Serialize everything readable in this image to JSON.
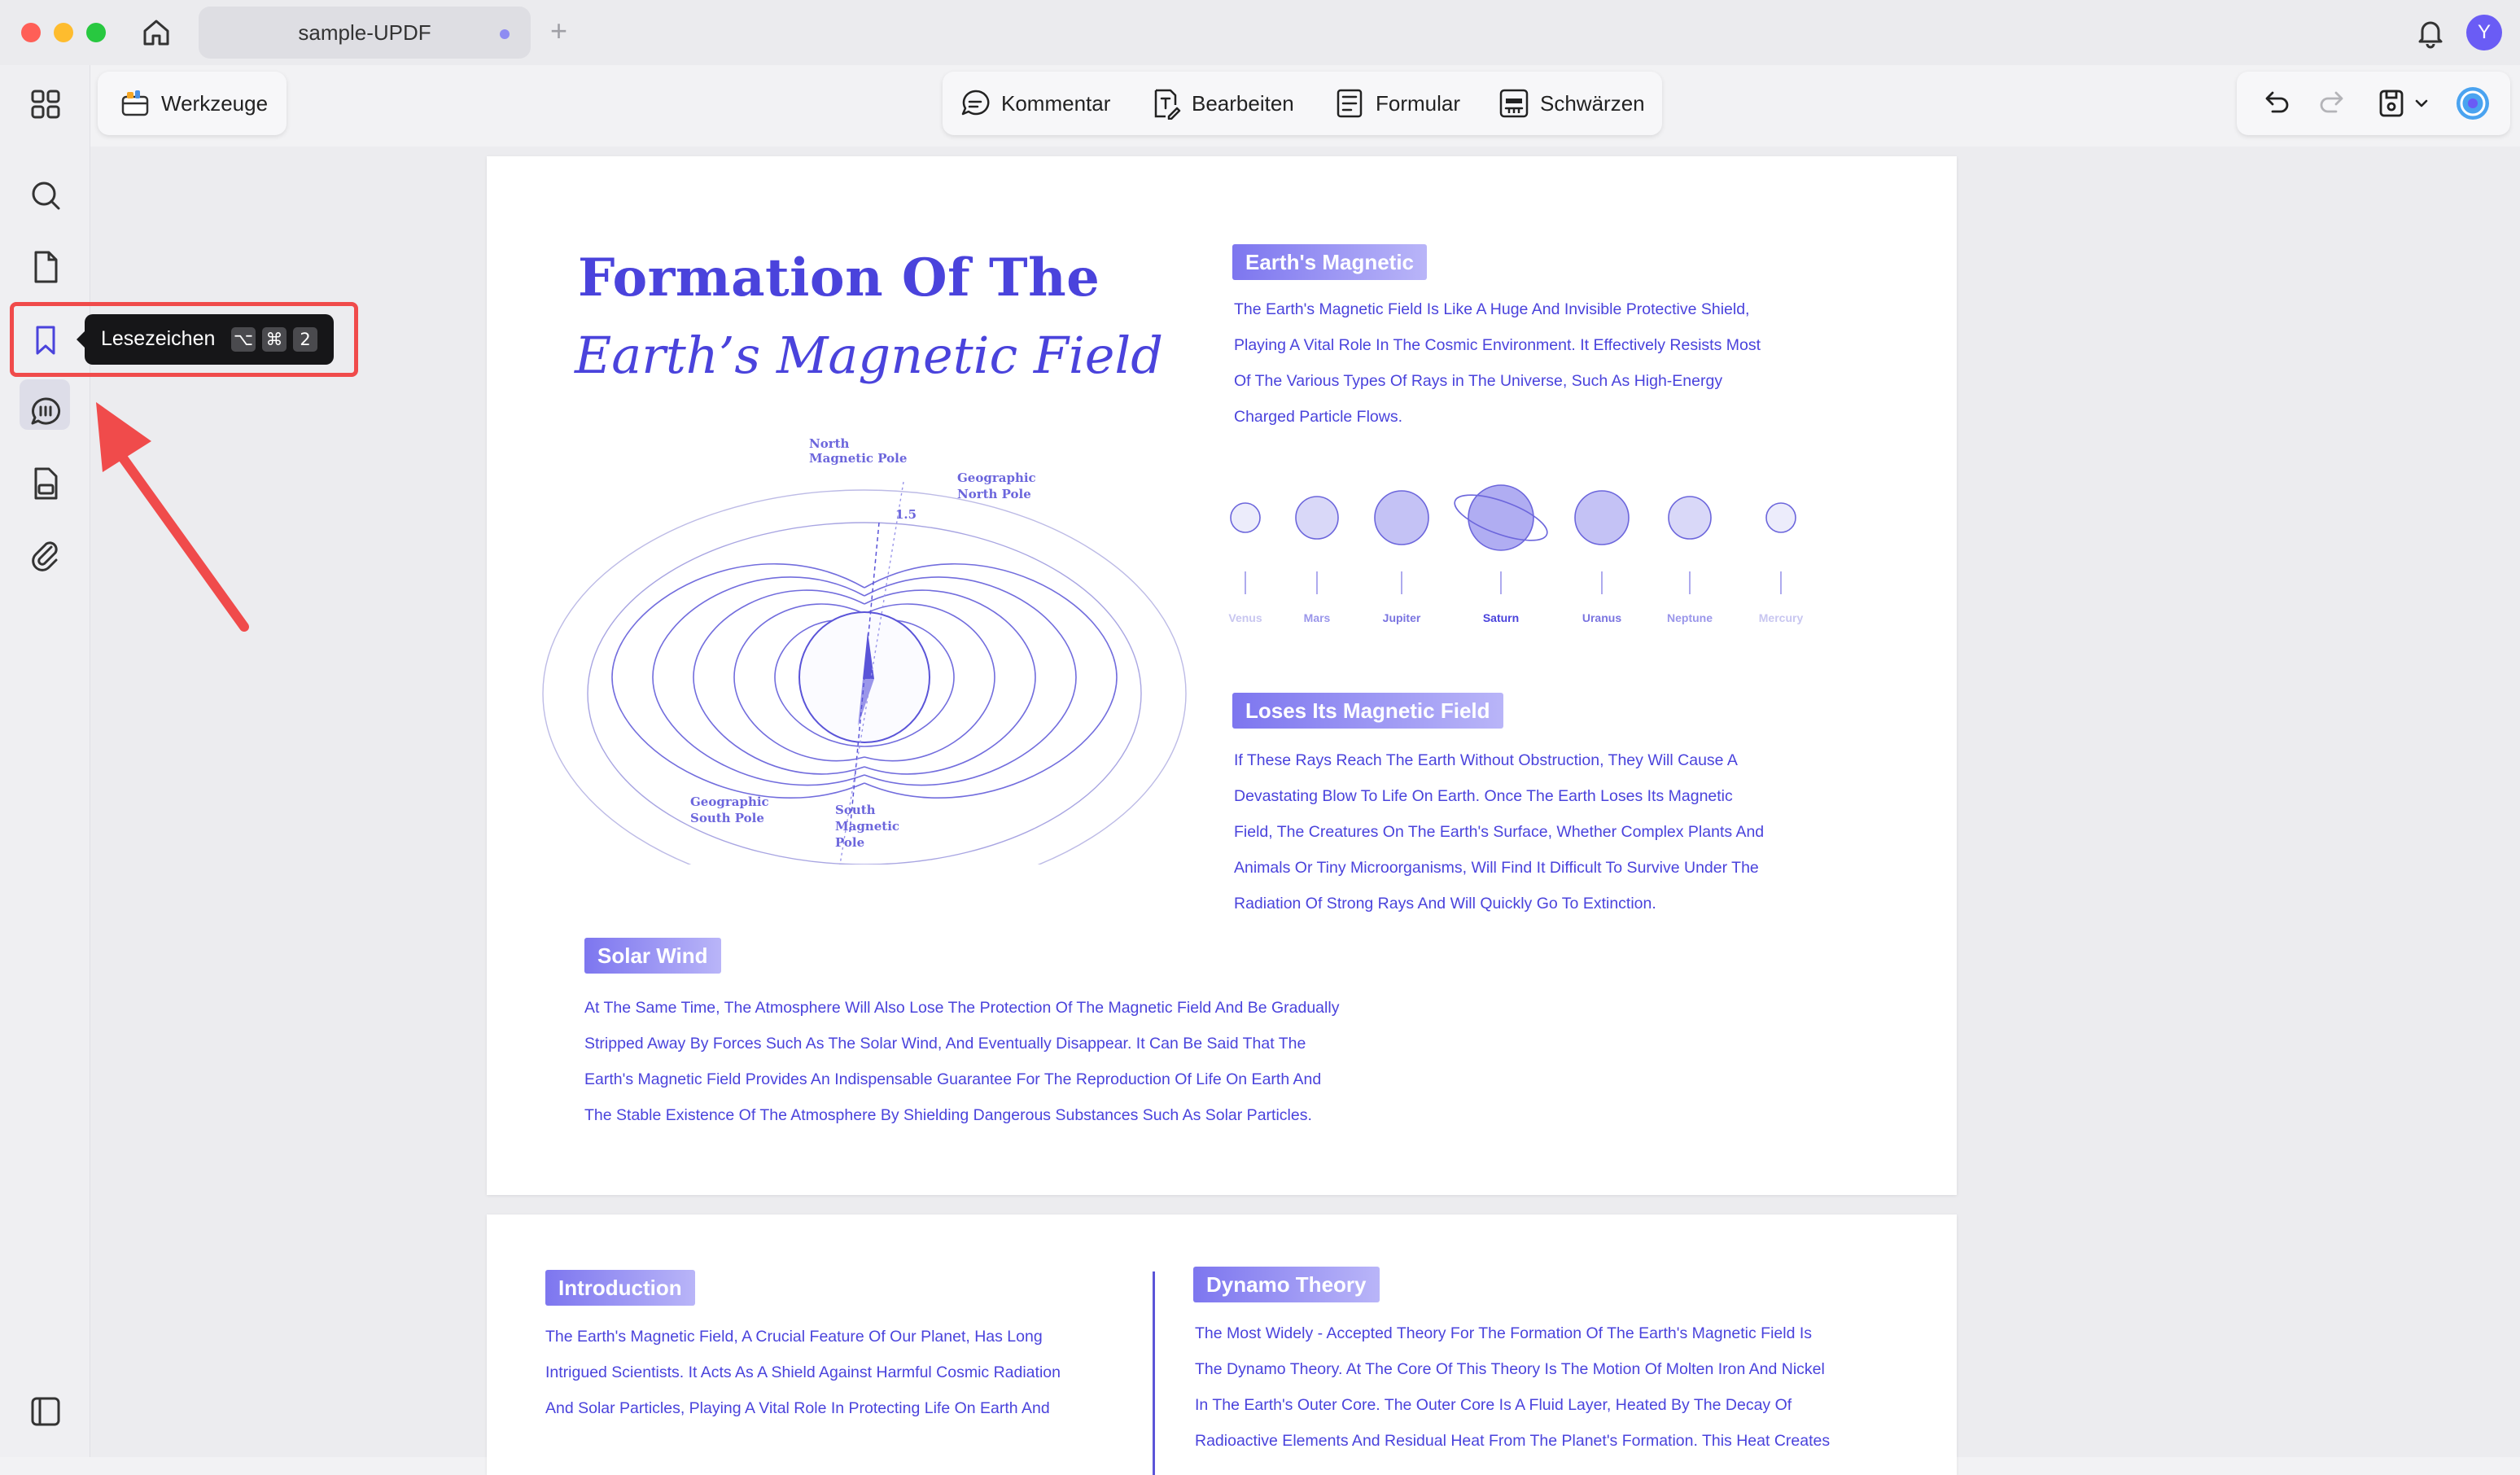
{
  "app": {
    "tab_title": "sample-UPDF",
    "new_tab": "+",
    "avatar_initial": "Y"
  },
  "toolbar": {
    "tools_label": "Werkzeuge",
    "comment_label": "Kommentar",
    "edit_label": "Bearbeiten",
    "form_label": "Formular",
    "redact_label": "Schwärzen"
  },
  "sidebar": {
    "items": [
      {
        "name": "thumbnails-icon"
      },
      {
        "name": "search-icon"
      },
      {
        "name": "pages-icon"
      },
      {
        "name": "bookmark-icon"
      },
      {
        "name": "comments-icon"
      },
      {
        "name": "stamp-icon"
      },
      {
        "name": "attachment-icon"
      }
    ]
  },
  "tooltip": {
    "label": "Lesezeichen",
    "keys": [
      "⌥",
      "⌘",
      "2"
    ]
  },
  "colors": {
    "accent": "#4a43dc",
    "highlight": "#f04b4b"
  },
  "page1": {
    "title_line1": "Formation Of The",
    "title_line2": "Earth’s Magnetic Field",
    "diagram_labels": {
      "north_magnetic_pole": [
        "North",
        "Magnetic Pole"
      ],
      "geographic_north_pole": [
        "Geographic",
        "North Pole"
      ],
      "angle": "1.5",
      "geographic_south_pole": [
        "Geographic",
        "South Pole"
      ],
      "south_magnetic_pole": [
        "South",
        "Magnetic",
        "Pole"
      ]
    },
    "section_magnetic": {
      "heading": "Earth's Magnetic",
      "lines": [
        "The Earth's Magnetic Field Is Like A Huge And Invisible Protective Shield,",
        "Playing A Vital Role In The Cosmic Environment. It Effectively Resists Most",
        "Of The Various Types Of Rays in The Universe, Such As High-Energy",
        "Charged Particle Flows."
      ]
    },
    "planets": [
      "Venus",
      "Mars",
      "Jupiter",
      "Saturn",
      "Uranus",
      "Neptune",
      "Mercury"
    ],
    "section_loses": {
      "heading": "Loses Its Magnetic Field",
      "lines": [
        "If These Rays Reach The Earth Without Obstruction, They Will Cause A",
        "Devastating Blow To Life On Earth. Once The Earth Loses Its Magnetic",
        "Field, The Creatures On The Earth's Surface, Whether Complex Plants And",
        "Animals Or Tiny Microorganisms, Will Find It Difficult To Survive Under The",
        "Radiation Of Strong Rays And Will Quickly Go To Extinction."
      ]
    },
    "section_solar": {
      "heading": "Solar Wind",
      "lines": [
        "At The Same Time, The Atmosphere Will Also Lose The Protection Of The Magnetic Field And Be Gradually",
        "Stripped Away By Forces Such As The Solar Wind, And Eventually Disappear. It Can Be Said That The",
        "Earth's Magnetic Field Provides An Indispensable Guarantee For The Reproduction Of Life On Earth And",
        "The Stable Existence Of The Atmosphere By Shielding Dangerous Substances Such As Solar Particles."
      ]
    }
  },
  "page2": {
    "section_intro": {
      "heading": "Introduction",
      "lines": [
        "The Earth's Magnetic Field, A Crucial Feature Of Our Planet, Has Long",
        "Intrigued Scientists. It Acts As A Shield Against Harmful Cosmic Radiation",
        "And Solar Particles, Playing A Vital Role In Protecting Life On Earth And"
      ]
    },
    "section_dynamo": {
      "heading": "Dynamo Theory",
      "lines": [
        "The Most Widely - Accepted Theory For The Formation Of The Earth's Magnetic Field Is",
        "The Dynamo Theory. At The Core Of This Theory Is The Motion Of Molten Iron And Nickel",
        "In The Earth's Outer Core. The Outer Core Is A Fluid Layer, Heated By The Decay Of",
        "Radioactive Elements And Residual Heat From The Planet's Formation. This Heat Creates"
      ]
    }
  }
}
